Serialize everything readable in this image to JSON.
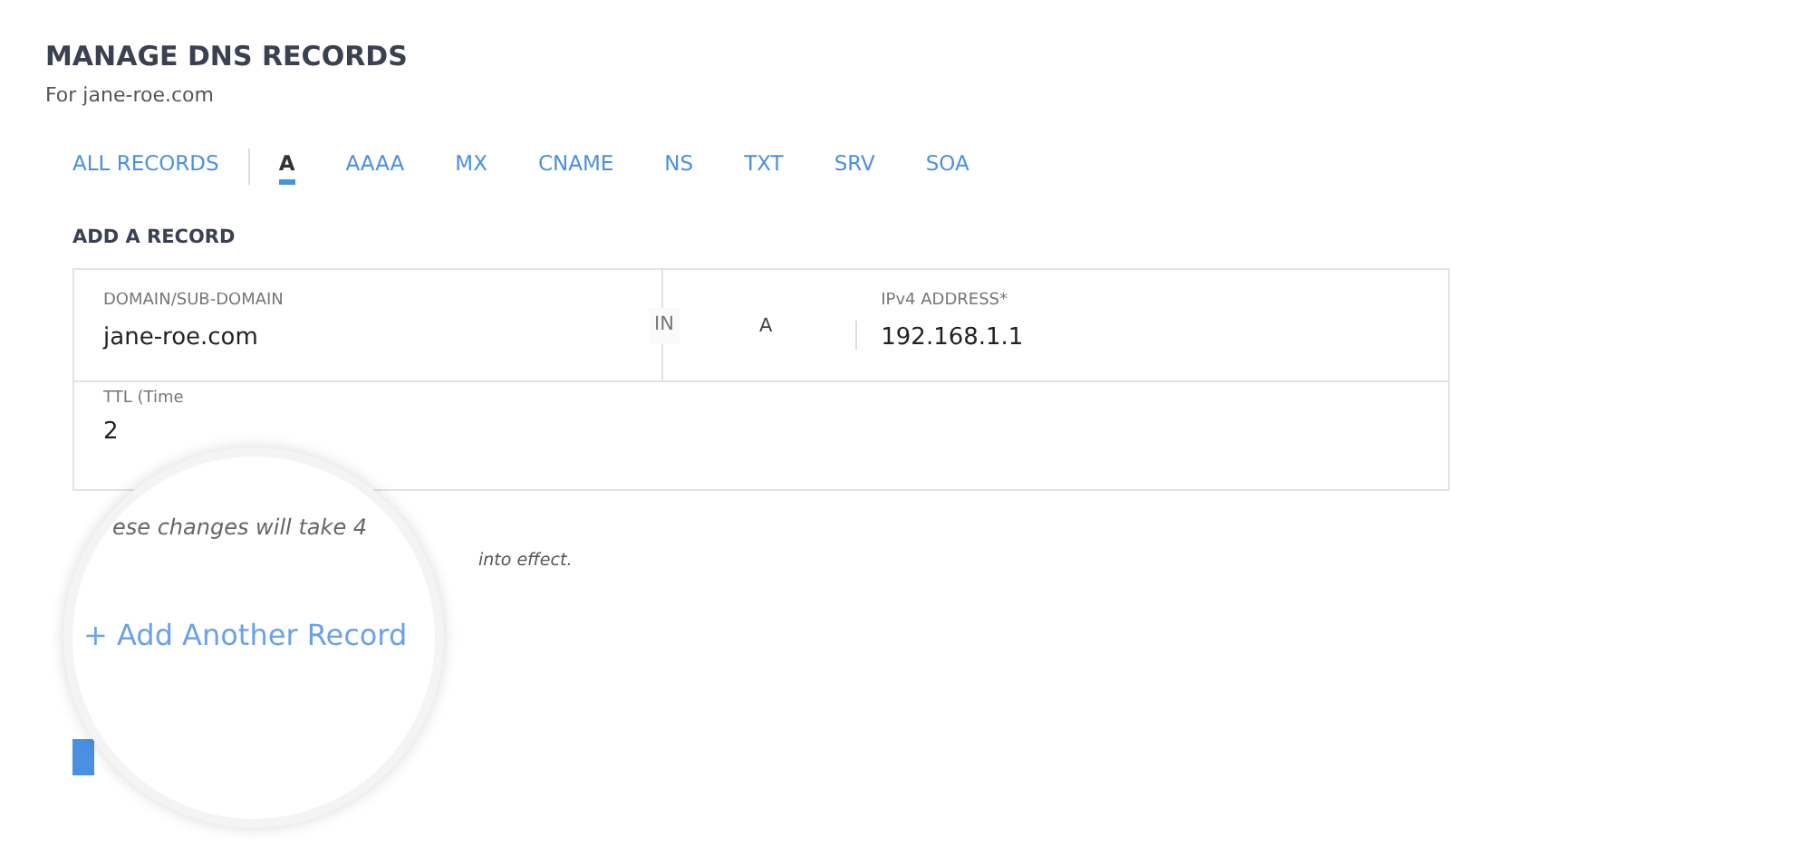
{
  "title": "MANAGE DNS RECORDS",
  "subtitle": "For jane-roe.com",
  "tabs": [
    {
      "label": "ALL RECORDS",
      "selected": false
    },
    {
      "label": "A",
      "selected": true
    },
    {
      "label": "AAAA",
      "selected": false
    },
    {
      "label": "MX",
      "selected": false
    },
    {
      "label": "CNAME",
      "selected": false
    },
    {
      "label": "NS",
      "selected": false
    },
    {
      "label": "TXT",
      "selected": false
    },
    {
      "label": "SRV",
      "selected": false
    },
    {
      "label": "SOA",
      "selected": false
    }
  ],
  "section_title": "ADD A RECORD",
  "record": {
    "domain_label": "DOMAIN/SUB-DOMAIN",
    "domain_value": "jane-roe.com",
    "class_text": "IN",
    "type_text": "A",
    "address_label": "IPv4 ADDRESS*",
    "address_value": "192.168.1.1",
    "ttl_label": "TTL (Time",
    "ttl_value": "2"
  },
  "note_end": "into effect.",
  "magnifier": {
    "note": "ese changes will take 4",
    "link": "+ Add Another Record"
  }
}
